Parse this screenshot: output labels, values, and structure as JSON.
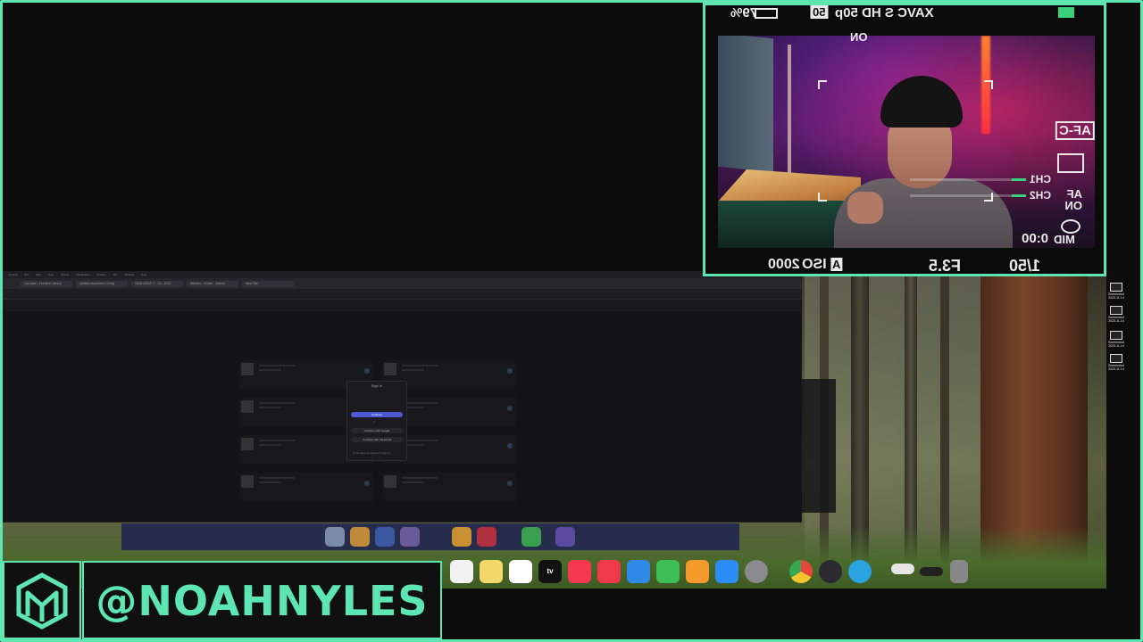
{
  "colors": {
    "accent": "#5ee6b2",
    "browser_bg": "#17171c",
    "primary_button": "#4f59d6"
  },
  "camera_hud": {
    "battery": "79%",
    "recording_format": "XAVC S HD 50p",
    "format_badge": "50",
    "steady_on": "ON",
    "focus_mode": "AF-C",
    "audio_ch1": "CH1",
    "audio_ch2": "CH2",
    "af_on": "AF ON",
    "metering": "MID",
    "timecode": "0:00",
    "iso_label": "ISO",
    "iso_value": "2000",
    "iso_mode": "A",
    "aperture": "F3.5",
    "shutter": "1/50",
    "audio_ch1_level": 0.12,
    "audio_ch2_level": 0.12
  },
  "browser": {
    "menubar": [
      "Chrome",
      "File",
      "Edit",
      "View",
      "History",
      "Bookmarks",
      "Profiles",
      "Tab",
      "Window",
      "Help"
    ],
    "tabs": [
      "Carousel | Creative Library",
      "untitled-document | Craig",
      "ZA26-AGLE-T - ZA - 2022",
      "Wander - Ember - Assets",
      "New Tab"
    ],
    "dialog": {
      "title": "Sign In",
      "primary_button": "Continue",
      "separator": "or",
      "buttons": [
        "Continue with Google",
        "Continue with Facebook"
      ],
      "footer": "Don't have an account? Sign up"
    }
  },
  "desktop_files": [
    {
      "label": "Screenshot 2023-11-14"
    },
    {
      "label": "Screenshot 2023-11-14"
    },
    {
      "label": "Screenshot 2023-11-14"
    },
    {
      "label": "Screenshot 2023-11-14"
    }
  ],
  "dock_apps": [
    "Reminders",
    "Notes",
    "Freeform",
    "TV",
    "Music",
    "News",
    "Keynote",
    "Numbers",
    "Pages",
    "App Store",
    "System Settings",
    "Chrome",
    "OBS",
    "Telegram",
    "Finder",
    "Trash"
  ],
  "dock_tv_label": "tv",
  "banner": {
    "handle": "@NOAHNYLES",
    "logo_text": "M"
  }
}
